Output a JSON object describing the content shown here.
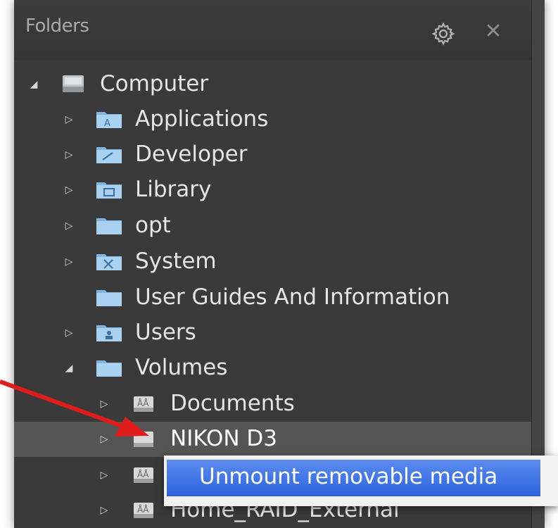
{
  "panel": {
    "title": "Folders",
    "settings_icon": "gear-icon",
    "close_icon": "close-icon"
  },
  "tree": [
    {
      "label": "Computer",
      "expander": "expanded",
      "icon": "computer-drive-icon"
    },
    {
      "label": "Applications",
      "expander": "collapsed",
      "icon": "applications-folder-icon"
    },
    {
      "label": "Developer",
      "expander": "collapsed",
      "icon": "developer-folder-icon"
    },
    {
      "label": "Library",
      "expander": "collapsed",
      "icon": "library-folder-icon"
    },
    {
      "label": "opt",
      "expander": "collapsed",
      "icon": "folder-icon"
    },
    {
      "label": "System",
      "expander": "collapsed",
      "icon": "system-folder-icon"
    },
    {
      "label": "User Guides And Information",
      "expander": "none",
      "icon": "folder-icon"
    },
    {
      "label": "Users",
      "expander": "collapsed",
      "icon": "users-folder-icon"
    },
    {
      "label": "Volumes",
      "expander": "expanded",
      "icon": "folder-icon"
    },
    {
      "label": "Documents",
      "expander": "collapsed",
      "icon": "network-drive-icon"
    },
    {
      "label": "NIKON D3",
      "expander": "collapsed",
      "icon": "removable-drive-icon",
      "selected": true
    },
    {
      "label": "",
      "expander": "collapsed",
      "icon": "network-drive-icon"
    },
    {
      "label": "Home_RAID_External",
      "expander": "collapsed",
      "icon": "network-drive-icon"
    }
  ],
  "context_menu": {
    "items": [
      "Unmount removable media"
    ]
  },
  "colors": {
    "panel_bg": "#3a3a3a",
    "selection": "#555555",
    "menu_highlight": "#2c62de",
    "arrow": "#e01b1b"
  }
}
